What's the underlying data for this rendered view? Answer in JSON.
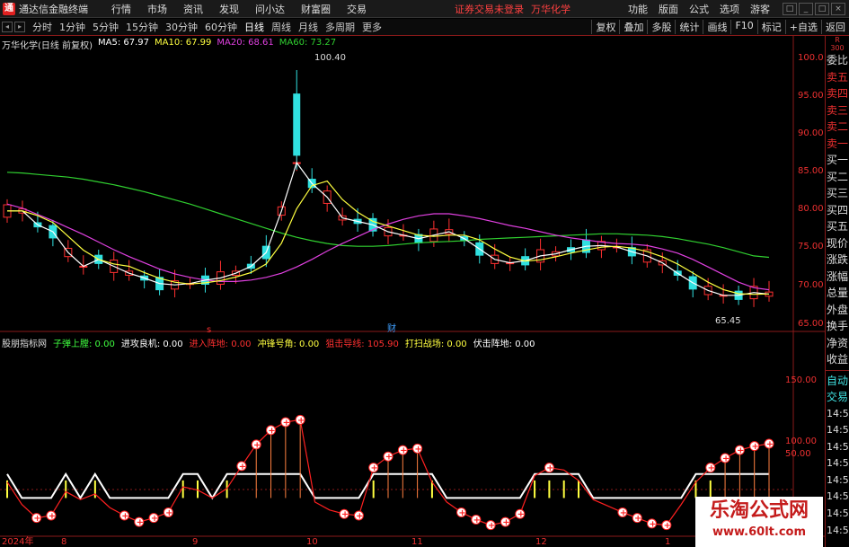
{
  "app": {
    "title": "通达信金融终端",
    "logo_glyph": "通"
  },
  "menu": [
    "行情",
    "市场",
    "资讯",
    "发现",
    "问小达",
    "财富圈",
    "交易"
  ],
  "status": {
    "warning": "证券交易未登录",
    "stock_name": "万华化学"
  },
  "menu_right": [
    "功能",
    "版面",
    "公式",
    "选项",
    "游客"
  ],
  "window_buttons": [
    "□",
    "_",
    "□",
    "×"
  ],
  "periods": [
    "分时",
    "1分钟",
    "5分钟",
    "15分钟",
    "30分钟",
    "60分钟",
    "日线",
    "周线",
    "月线",
    "多周期",
    "更多"
  ],
  "active_period": "日线",
  "tools": [
    "复权",
    "叠加",
    "多股",
    "统计",
    "画线",
    "F10",
    "标记",
    "+自选",
    "返回"
  ],
  "main_legend": {
    "title": "万华化学(日线 前复权)",
    "ma5": "MA5: 67.97",
    "ma10": "MA10: 67.99",
    "ma20": "MA20: 68.61",
    "ma60": "MA60: 73.27"
  },
  "price_axis": [
    "100.0",
    "95.00",
    "90.00",
    "85.00",
    "80.00",
    "75.00",
    "70.00",
    "65.00"
  ],
  "annotations": {
    "high": "100.40",
    "low": "65.45",
    "marker_s": "s",
    "marker_cai": "财"
  },
  "sub_legend": {
    "name": "股朋指标网",
    "l1": "子弹上膛: 0.00",
    "l2": "进攻良机: 0.00",
    "l3": "进入阵地: 0.00",
    "l4": "冲锋号角: 0.00",
    "l5": "狙击导线: 105.90",
    "l6": "打扫战场: 0.00",
    "l7": "伏击阵地: 0.00"
  },
  "sub_axis": [
    "150.00",
    "100.00",
    "50.00"
  ],
  "date_axis": [
    "2024年",
    "8",
    "9",
    "10",
    "11",
    "12",
    "1"
  ],
  "side_header": [
    "R",
    "300"
  ],
  "side_items": [
    "委比",
    "卖五",
    "卖四",
    "卖三",
    "卖二",
    "卖一",
    "买一",
    "买二",
    "买三",
    "买四",
    "买五",
    "现价",
    "涨跌",
    "涨幅",
    "总量",
    "外盘",
    "换手",
    "净资",
    "收益"
  ],
  "side_bottom": [
    "自动",
    "交易"
  ],
  "side_times": [
    "14:56",
    "14:56",
    "14:56",
    "14:56",
    "14:56",
    "14:56",
    "14:56",
    "14:56"
  ],
  "watermark": {
    "cn": "乐淘公式网",
    "url": "www.60lt.com"
  },
  "colors": {
    "up": "#ff3030",
    "down": "#30e0e0",
    "ma5": "#ffffff",
    "ma10": "#ffff40",
    "ma20": "#e040e0",
    "ma60": "#30d030"
  },
  "chart_data": {
    "type": "candlestick",
    "price_ylim": [
      64,
      103
    ],
    "sub_ylim": [
      -40,
      185
    ],
    "candles": [],
    "ma60": [
      85.6,
      85.5,
      85.3,
      85.1,
      84.9,
      84.6,
      84.2,
      83.8,
      83.3,
      82.8,
      82.2,
      81.6,
      81.0,
      80.3,
      79.6,
      78.9,
      78.2,
      77.5,
      76.8,
      76.2,
      75.7,
      75.3,
      75.0,
      74.9,
      74.9,
      75.0,
      75.2,
      75.4,
      75.5,
      75.6,
      75.7,
      75.9,
      76.0,
      76.1,
      76.2,
      76.3,
      76.4,
      76.5,
      76.6,
      76.7,
      76.7,
      76.6,
      76.5,
      76.3,
      76.0,
      75.6,
      75.2,
      74.7,
      74.1,
      73.5,
      73.3
    ],
    "ma20": [
      81,
      80.4,
      79.5,
      78.6,
      77.6,
      76.6,
      75.5,
      74.4,
      73.4,
      72.5,
      71.6,
      70.9,
      70.4,
      70.0,
      69.8,
      69.8,
      70.0,
      70.4,
      71.0,
      71.9,
      73.0,
      74.2,
      75.3,
      76.3,
      77.3,
      78.1,
      78.8,
      79.3,
      79.6,
      79.6,
      79.3,
      78.9,
      78.4,
      77.9,
      77.5,
      77.0,
      76.5,
      76.1,
      75.8,
      75.5,
      75.3,
      75.2,
      75.0,
      74.5,
      73.9,
      73.0,
      71.9,
      70.8,
      69.7,
      68.9,
      68.6
    ],
    "ma5": [
      80,
      80,
      78,
      77,
      74,
      72,
      73,
      72,
      71,
      70.3,
      69.5,
      69.3,
      69.5,
      70,
      70.3,
      71,
      72,
      74,
      80,
      87,
      84,
      82,
      79,
      78.5,
      78,
      77,
      76.5,
      76,
      76.5,
      77,
      76,
      74.5,
      73,
      72.5,
      72.8,
      73.5,
      73.8,
      74.4,
      74.9,
      75,
      74.8,
      74.1,
      73.5,
      72.5,
      71,
      69.6,
      68.5,
      67.8,
      67.8,
      68.2,
      67.97
    ]
  },
  "ind_data": [
    20,
    -8,
    -25,
    -22,
    8,
    -2,
    5,
    -12,
    -22,
    -30,
    -25,
    -18,
    14,
    10,
    0,
    12,
    40,
    67,
    85,
    95,
    98,
    -5,
    -15,
    -20,
    -22,
    38,
    52,
    60,
    62,
    20,
    -5,
    -18,
    -27,
    -34,
    -30,
    -20,
    28,
    38,
    35,
    22,
    -2,
    -10,
    -18,
    -25,
    -32,
    -34,
    -8,
    20,
    38,
    50,
    60,
    65,
    68
  ]
}
